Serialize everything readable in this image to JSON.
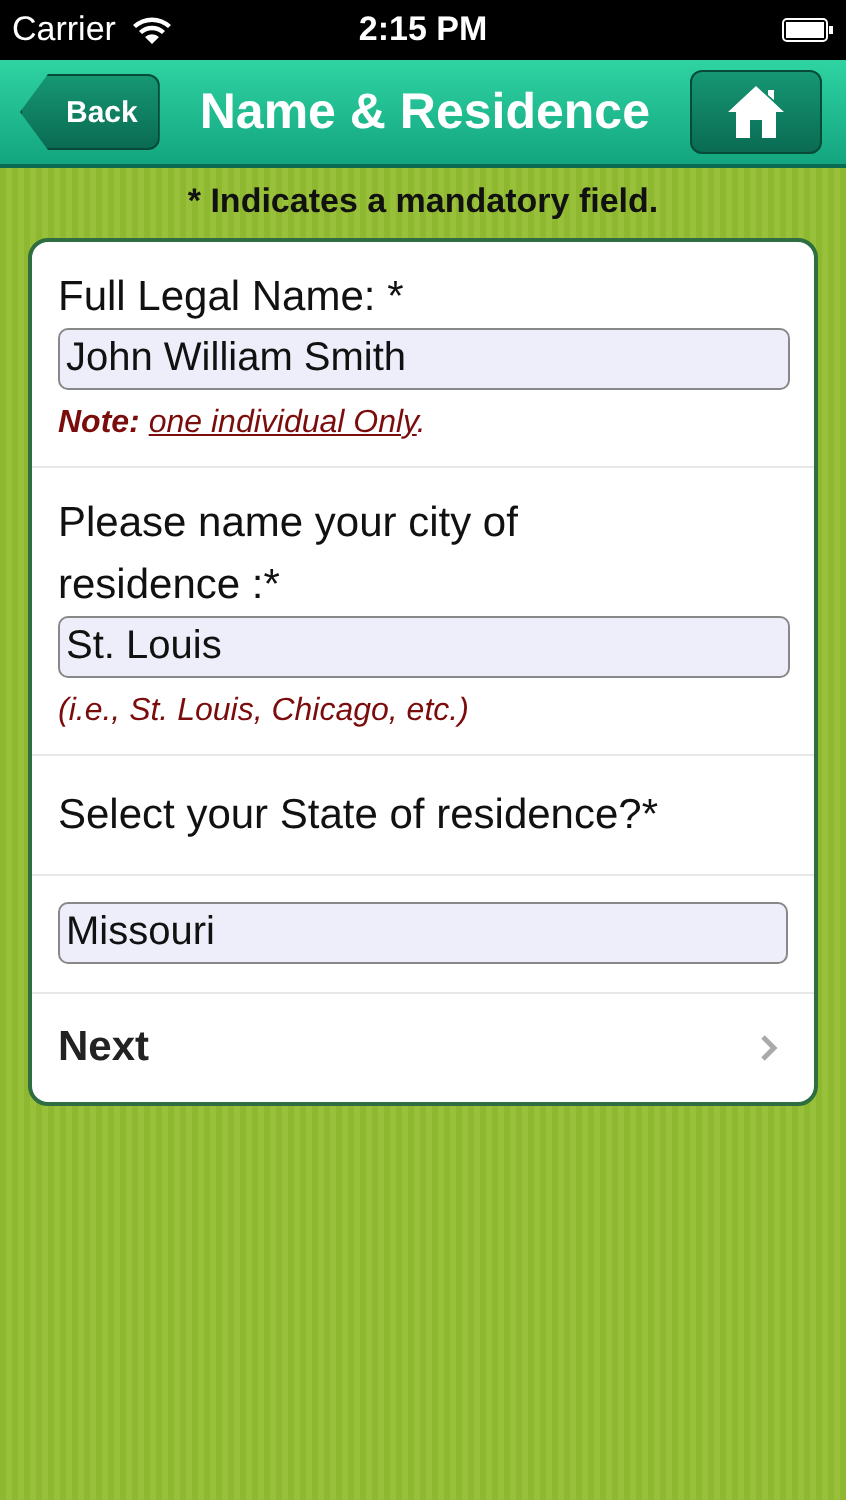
{
  "status_bar": {
    "carrier": "Carrier",
    "time": "2:15 PM"
  },
  "nav": {
    "back": "Back",
    "title": "Name & Residence"
  },
  "banner": "* Indicates a mandatory field.",
  "form": [
    {
      "kind": "field",
      "label": "Full Legal Name: *",
      "value": "John William Smith",
      "note": {
        "label": "Note:",
        "link": "one individual Only",
        "end": "."
      }
    },
    {
      "kind": "field",
      "label": "Please name your city of residence :*",
      "value": "St. Louis",
      "hint": "(i.e., St. Louis, Chicago, etc.)"
    },
    {
      "kind": "label",
      "label": "Select your State of residence?*"
    },
    {
      "kind": "select",
      "value": "Missouri"
    },
    {
      "kind": "next",
      "label": "Next"
    }
  ]
}
